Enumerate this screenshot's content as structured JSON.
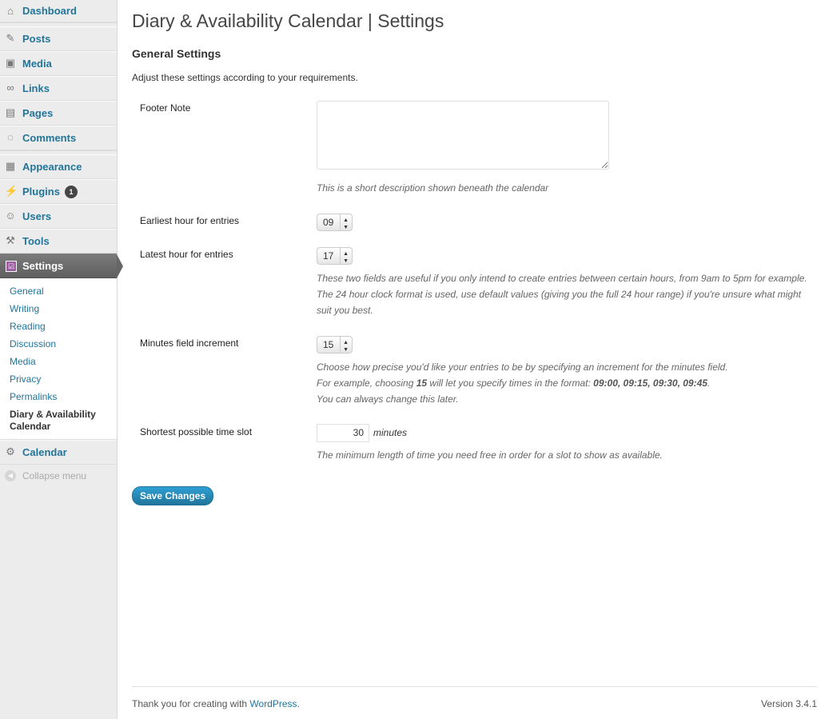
{
  "sidebar": {
    "menu": [
      {
        "label": "Dashboard",
        "icon": "dashboard-icon"
      },
      {
        "label": "Posts",
        "icon": "pin-icon"
      },
      {
        "label": "Media",
        "icon": "media-icon"
      },
      {
        "label": "Links",
        "icon": "link-icon"
      },
      {
        "label": "Pages",
        "icon": "pages-icon"
      },
      {
        "label": "Comments",
        "icon": "comment-icon"
      },
      {
        "label": "Appearance",
        "icon": "appearance-icon"
      },
      {
        "label": "Plugins",
        "icon": "plugin-icon",
        "badge": "1"
      },
      {
        "label": "Users",
        "icon": "users-icon"
      },
      {
        "label": "Tools",
        "icon": "tools-icon"
      },
      {
        "label": "Settings",
        "icon": "settings-icon"
      },
      {
        "label": "Calendar",
        "icon": "gear-icon"
      }
    ],
    "submenu": [
      "General",
      "Writing",
      "Reading",
      "Discussion",
      "Media",
      "Privacy",
      "Permalinks",
      "Diary & Availability Calendar"
    ],
    "collapse_label": "Collapse menu"
  },
  "page": {
    "title": "Diary & Availability Calendar | Settings",
    "section_title": "General Settings",
    "intro": "Adjust these settings according to your requirements."
  },
  "fields": {
    "footer_note_label": "Footer Note",
    "footer_note_value": "",
    "footer_note_desc": "This is a short description shown beneath the calendar",
    "earliest_label": "Earliest hour for entries",
    "earliest_value": "09",
    "latest_label": "Latest hour for entries",
    "latest_value": "17",
    "hours_desc_1": "These two fields are useful if you only intend to create entries between certain hours, from 9am to 5pm for example.",
    "hours_desc_2": "The 24 hour clock format is used, use default values (giving you the full 24 hour range) if you're unsure what might",
    "hours_desc_3": "suit you best.",
    "minutes_label": "Minutes field increment",
    "minutes_value": "15",
    "minutes_desc_1": "Choose how precise you'd like your entries to be by specifying an increment for the minutes field.",
    "minutes_desc_2a": "For example, choosing ",
    "minutes_desc_2b": "15",
    "minutes_desc_2c": " will let you specify times in the format: ",
    "minutes_desc_2d": "09:00, 09:15, 09:30, 09:45",
    "minutes_desc_2e": ".",
    "minutes_desc_3": "You can always change this later.",
    "slot_label": "Shortest possible time slot",
    "slot_value": "30",
    "slot_unit": "minutes",
    "slot_desc": "The minimum length of time you need free in order for a slot to show as available."
  },
  "actions": {
    "save_label": "Save Changes"
  },
  "footer": {
    "thanks_prefix": "Thank you for creating with ",
    "thanks_link": "WordPress",
    "thanks_suffix": ".",
    "version": "Version 3.4.1"
  },
  "colors": {
    "link": "#21759b",
    "button": "#21759b",
    "current_menu": "#666666"
  }
}
